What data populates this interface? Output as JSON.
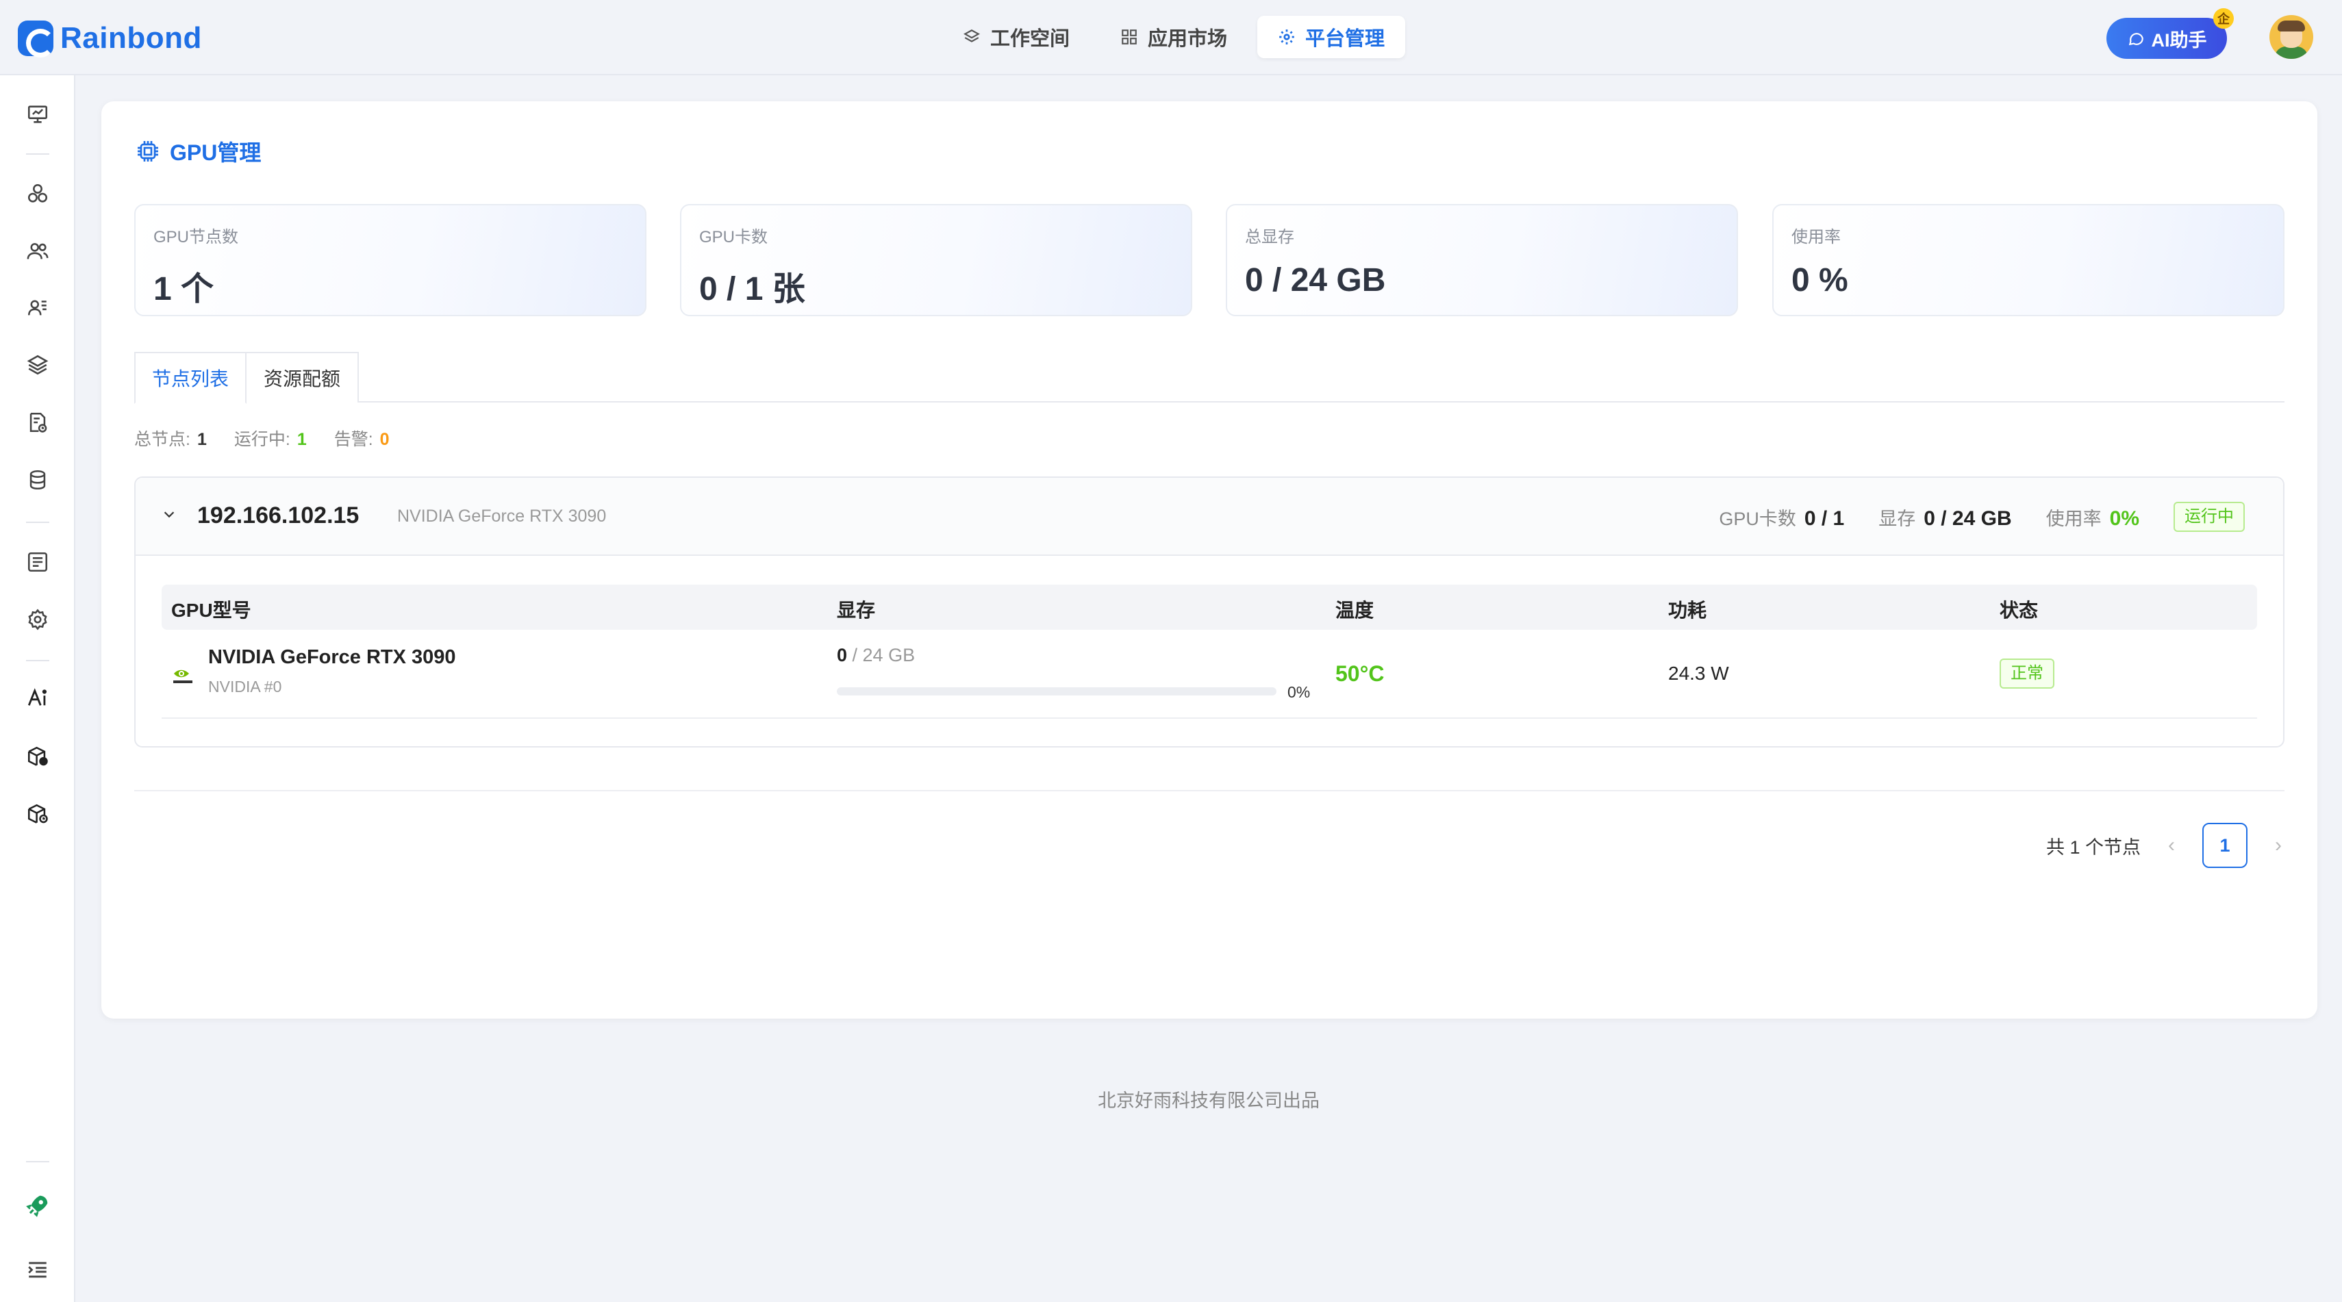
{
  "brand": {
    "name": "Rainbond"
  },
  "nav": {
    "items": [
      {
        "label": "工作空间",
        "icon": "layers-icon",
        "active": false
      },
      {
        "label": "应用市场",
        "icon": "grid-icon",
        "active": false
      },
      {
        "label": "平台管理",
        "icon": "gear-icon",
        "active": true
      }
    ]
  },
  "ai": {
    "label": "AI助手",
    "badge": "企"
  },
  "sidebar": {
    "items": [
      "monitor-icon",
      "cluster-icon",
      "users-icon",
      "contacts-icon",
      "layers-icon",
      "report-icon",
      "database-icon",
      "list-icon",
      "settings-icon",
      "ai-icon",
      "package-icon",
      "package-2-icon",
      "rocket-icon",
      "collapse-icon"
    ]
  },
  "page": {
    "title": "GPU管理"
  },
  "stats": [
    {
      "label": "GPU节点数",
      "value": "1 个"
    },
    {
      "label": "GPU卡数",
      "value": "0 / 1 张"
    },
    {
      "label": "总显存",
      "value": "0 / 24 GB"
    },
    {
      "label": "使用率",
      "value": "0 %"
    }
  ],
  "tabs": [
    {
      "label": "节点列表",
      "active": true
    },
    {
      "label": "资源配额",
      "active": false
    }
  ],
  "summary": {
    "total_label": "总节点:",
    "total": "1",
    "running_label": "运行中:",
    "running": "1",
    "alert_label": "告警:",
    "alert": "0"
  },
  "node": {
    "ip": "192.166.102.15",
    "model": "NVIDIA GeForce RTX 3090",
    "gpu_label": "GPU卡数",
    "gpu_value": "0 / 1",
    "mem_label": "显存",
    "mem_value": "0 / 24 GB",
    "usage_label": "使用率",
    "usage_value": "0%",
    "status": "运行中"
  },
  "table": {
    "headers": [
      "GPU型号",
      "显存",
      "温度",
      "功耗",
      "状态"
    ],
    "rows": [
      {
        "name": "NVIDIA GeForce RTX 3090",
        "sub": "NVIDIA #0",
        "mem_used": "0",
        "mem_total": " / 24 GB",
        "mem_pct": "0%",
        "mem_fraction": 0,
        "temp": "50°C",
        "power": "24.3 W",
        "status": "正常"
      }
    ]
  },
  "pager": {
    "total_text": "共 1 个节点",
    "current": "1"
  },
  "footer": "北京好雨科技有限公司出品",
  "colors": {
    "primary": "#1f6fe5",
    "success": "#52c41a",
    "warning": "#fa9a14"
  }
}
